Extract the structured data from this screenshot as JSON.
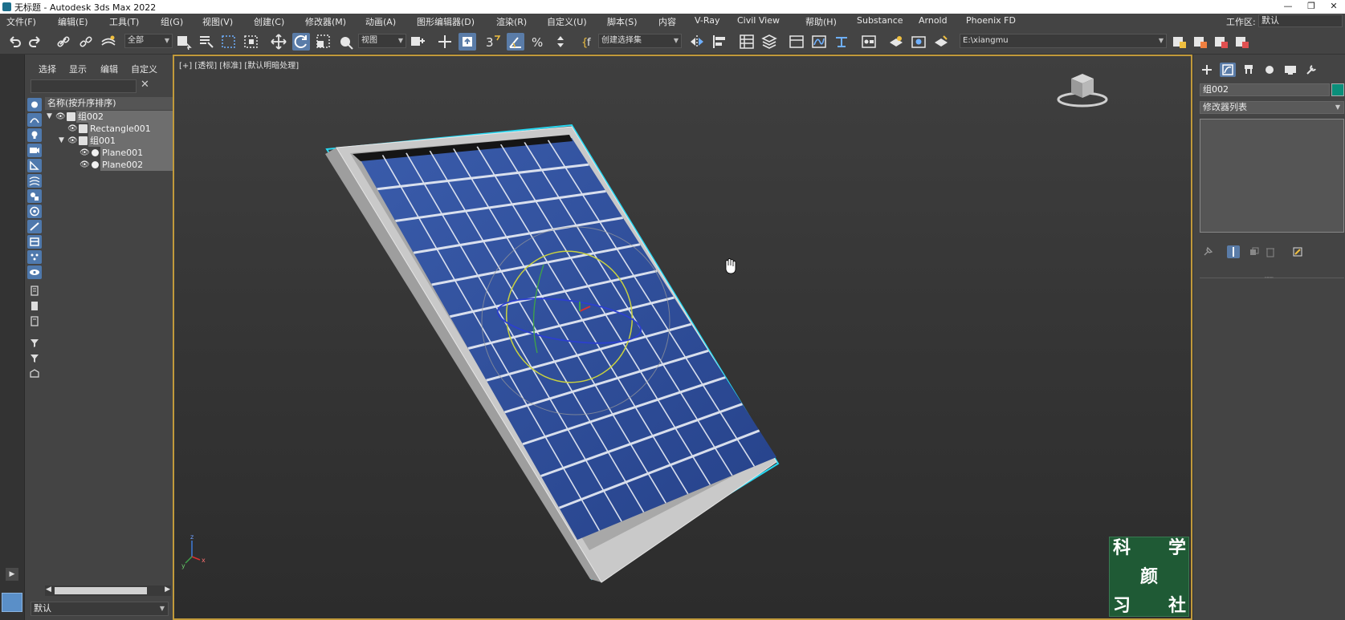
{
  "titlebar": {
    "title": "无标题 - Autodesk 3ds Max 2022",
    "minimize": "—",
    "restore": "❐",
    "close": "✕"
  },
  "menubar": {
    "items": [
      "文件(F)",
      "编辑(E)",
      "工具(T)",
      "组(G)",
      "视图(V)",
      "创建(C)",
      "修改器(M)",
      "动画(A)",
      "图形编辑器(D)",
      "渲染(R)",
      "自定义(U)",
      "脚本(S)",
      "内容",
      "V-Ray",
      "Civil View",
      "帮助(H)",
      "Substance",
      "Arnold",
      "Phoenix FD"
    ],
    "workspace_label": "工作区:",
    "workspace_value": "默认"
  },
  "toolbar": {
    "filter_dropdown": "全部",
    "coord_dropdown": "视图",
    "selection_set": "创建选择集",
    "project_path": "E:\\xiangmu",
    "icons": [
      "undo-icon",
      "redo-icon",
      "link-icon",
      "unlink-icon",
      "bind-space-warp-icon",
      "select-icon",
      "select-by-name-icon",
      "rect-select-icon",
      "window-crossing-icon",
      "move-icon",
      "rotate-icon",
      "scale-icon",
      "placement-icon",
      "pivot-icon",
      "snap-toggle-icon",
      "angle-snap-icon",
      "percent-snap-icon",
      "spinner-snap-icon",
      "edit-named-sets-icon",
      "mirror-icon",
      "align-icon",
      "scene-explorer-icon",
      "layer-explorer-icon",
      "ribbon-icon",
      "curve-editor-icon",
      "schematic-view-icon",
      "material-editor-icon",
      "render-setup-icon",
      "rendered-frame-icon",
      "render-icon"
    ]
  },
  "explorer": {
    "tabs": [
      "选择",
      "显示",
      "编辑",
      "自定义"
    ],
    "tree_header": "名称(按升序排序)",
    "rows": [
      {
        "label": "组002",
        "type": "group",
        "depth": 0,
        "expanded": true
      },
      {
        "label": "Rectangle001",
        "type": "shape",
        "depth": 1
      },
      {
        "label": "组001",
        "type": "group",
        "depth": 1,
        "expanded": true
      },
      {
        "label": "Plane001",
        "type": "geometry",
        "depth": 2
      },
      {
        "label": "Plane002",
        "type": "geometry",
        "depth": 2
      }
    ],
    "layer_dropdown": "默认"
  },
  "viewport": {
    "label": "[+] [透视] [标准] [默认明暗处理]",
    "axis_labels": {
      "z": "z",
      "x": "x",
      "y": "y"
    },
    "panel_color": "#2f4f9c",
    "frame_color": "#c8c8c8",
    "selection_color": "#27d8f2",
    "cursor_icon": "hand-pan-icon"
  },
  "watermark": {
    "chars": [
      "科",
      "学",
      "颜",
      "习",
      "社"
    ]
  },
  "cmdpanel": {
    "tabs": [
      "create-icon",
      "modify-icon",
      "hierarchy-icon",
      "motion-icon",
      "display-icon",
      "utilities-icon"
    ],
    "object_name": "组002",
    "object_color": "#0a8f7a",
    "modifier_list": "修改器列表"
  }
}
